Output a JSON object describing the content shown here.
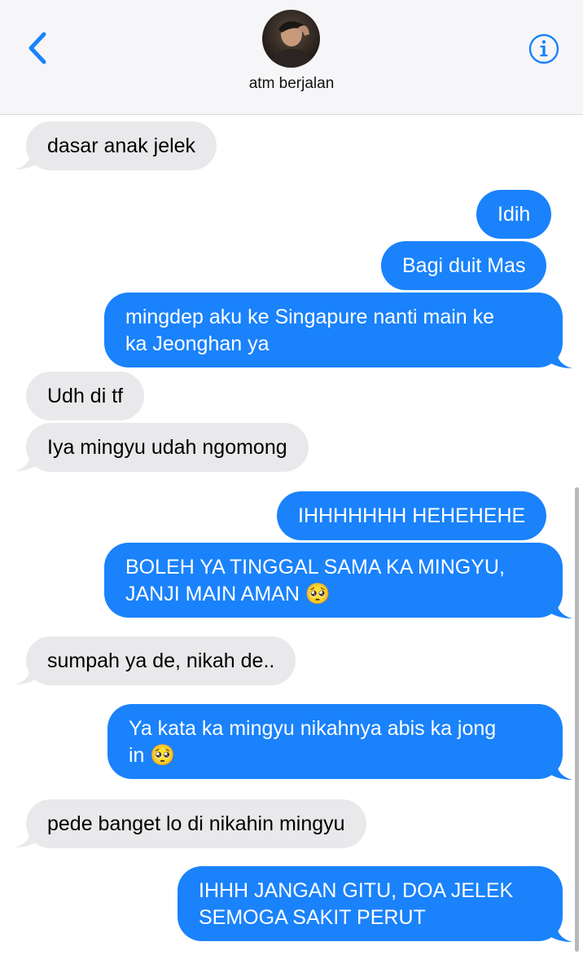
{
  "header": {
    "contact_name": "atm berjalan",
    "back_icon": "chevron-left-icon",
    "info_icon": "info-circle-icon",
    "accent_color": "#1a82fb"
  },
  "messages": [
    {
      "direction": "incoming",
      "text": "dasar anak jelek"
    },
    {
      "direction": "outgoing",
      "text": "Idih"
    },
    {
      "direction": "outgoing",
      "text": "Bagi duit Mas"
    },
    {
      "direction": "outgoing",
      "text": "mingdep aku ke Singapure nanti main ke\nka Jeonghan ya"
    },
    {
      "direction": "incoming",
      "text": "Udh di tf"
    },
    {
      "direction": "incoming",
      "text": "Iya mingyu udah ngomong"
    },
    {
      "direction": "outgoing",
      "text": "IHHHHHHH HEHEHEHE"
    },
    {
      "direction": "outgoing",
      "text": "BOLEH YA TINGGAL SAMA KA MINGYU,\nJANJI MAIN AMAN 🥺"
    },
    {
      "direction": "incoming",
      "text": "sumpah ya de, nikah de.."
    },
    {
      "direction": "outgoing",
      "text": "Ya kata ka mingyu nikahnya abis ka jong\nin 🥺"
    },
    {
      "direction": "incoming",
      "text": "pede banget lo di nikahin mingyu"
    },
    {
      "direction": "outgoing",
      "text": "IHHH JANGAN GITU, DOA JELEK\nSEMOGA SAKIT PERUT"
    }
  ]
}
